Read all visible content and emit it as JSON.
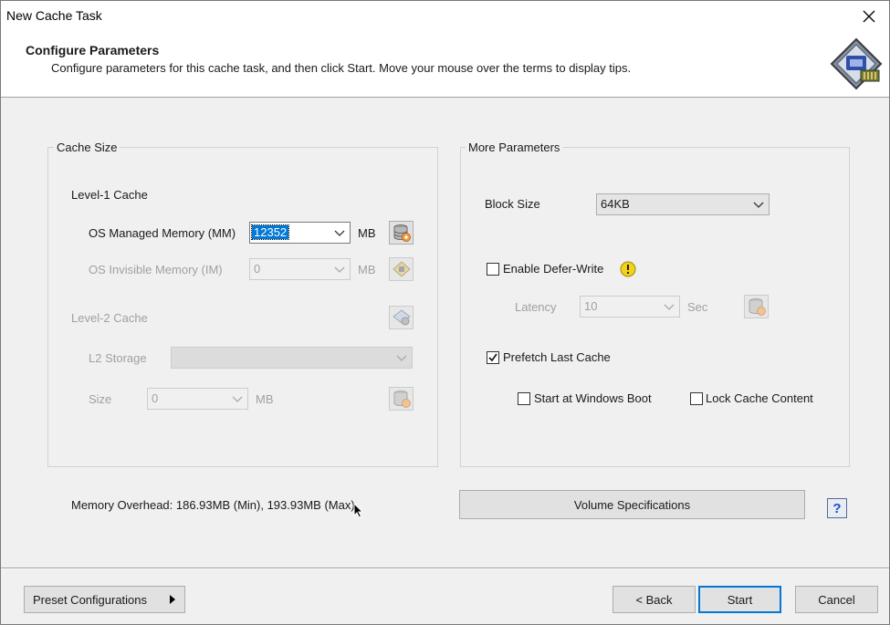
{
  "window": {
    "title": "New Cache Task"
  },
  "header": {
    "title": "Configure Parameters",
    "subtitle": "Configure parameters for this cache task, and then click Start. Move your mouse over the terms to display tips."
  },
  "cache_size": {
    "group_label": "Cache Size",
    "level1_label": "Level-1 Cache",
    "os_managed": {
      "label": "OS Managed Memory (MM)",
      "value": "12352",
      "unit": "MB"
    },
    "os_invisible": {
      "label": "OS Invisible Memory (IM)",
      "value": "0",
      "unit": "MB"
    },
    "level2_label": "Level-2 Cache",
    "l2_storage": {
      "label": "L2 Storage",
      "value": ""
    },
    "l2_size": {
      "label": "Size",
      "value": "0",
      "unit": "MB"
    }
  },
  "more_params": {
    "group_label": "More Parameters",
    "block_size": {
      "label": "Block Size",
      "value": "64KB"
    },
    "defer_write": {
      "label": "Enable Defer-Write",
      "checked": false
    },
    "latency": {
      "label": "Latency",
      "value": "10",
      "unit": "Sec"
    },
    "prefetch": {
      "label": "Prefetch Last Cache",
      "checked": true
    },
    "start_boot": {
      "label": "Start at Windows Boot",
      "checked": false
    },
    "lock_cache": {
      "label": "Lock Cache Content",
      "checked": false
    }
  },
  "memory_overhead": "Memory Overhead: 186.93MB (Min), 193.93MB (Max)",
  "volume_spec_label": "Volume Specifications",
  "help_label": "?",
  "footer": {
    "preset_label": "Preset Configurations",
    "back_label": "< Back",
    "start_label": "Start",
    "cancel_label": "Cancel"
  },
  "colors": {
    "accent": "#0078d7",
    "help": "#1f4fbf",
    "warning": "#f2d21b"
  }
}
